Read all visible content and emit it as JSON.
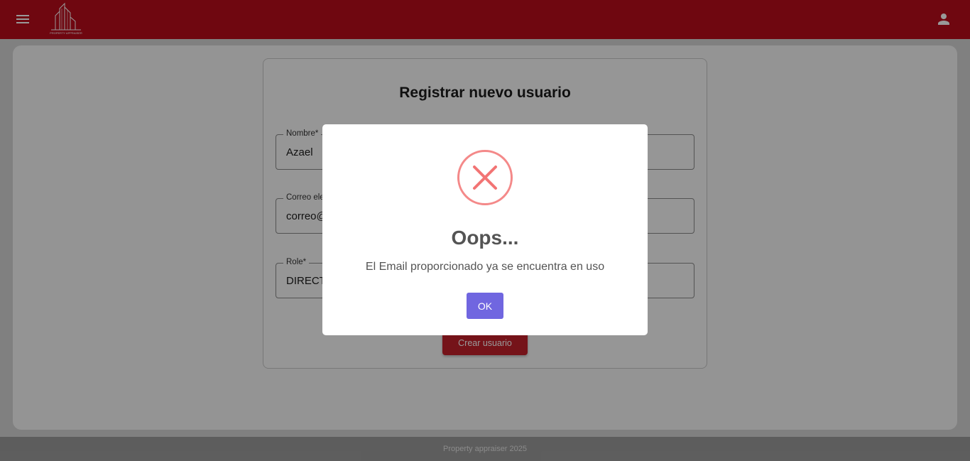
{
  "header": {
    "menu_icon": "menu-icon",
    "logo_text": "PROPERTY APPRAISER",
    "user_icon": "person-icon",
    "color": "#ba0c1c"
  },
  "form": {
    "title": "Registrar nuevo usuario",
    "fields": [
      {
        "label": "Nombre*",
        "value": "Azael"
      },
      {
        "label": "Correo ele",
        "value": "correo@"
      },
      {
        "label": "Role*",
        "value": "DIRECT"
      }
    ],
    "submit_label": "Crear usuario"
  },
  "footer": {
    "text": "Property appraiser 2025"
  },
  "modal": {
    "icon": "error-x-icon",
    "title": "Oops...",
    "message": "El Email proporcionado ya se encuentra en uso",
    "ok_label": "OK",
    "icon_color": "#f27474",
    "button_color": "#7066e0"
  }
}
